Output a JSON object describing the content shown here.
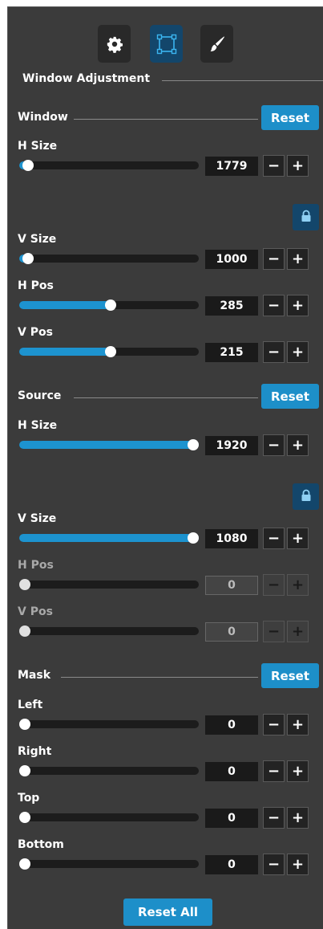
{
  "header": {
    "title": "Window Adjustment",
    "tabs": [
      {
        "icon": "gear-icon",
        "active": false
      },
      {
        "icon": "window-frame-icon",
        "active": true
      },
      {
        "icon": "brush-icon",
        "active": false
      }
    ]
  },
  "window": {
    "title": "Window",
    "reset_label": "Reset",
    "rows": [
      {
        "label": "H Size",
        "value": "1779",
        "fill": 0.05
      },
      {
        "label": "V Size",
        "value": "1000",
        "fill": 0.05
      },
      {
        "label": "H Pos",
        "value": "285",
        "fill": 0.51
      },
      {
        "label": "V Pos",
        "value": "215",
        "fill": 0.51
      }
    ]
  },
  "source": {
    "title": "Source",
    "reset_label": "Reset",
    "rows": [
      {
        "label": "H Size",
        "value": "1920",
        "fill": 1.0
      },
      {
        "label": "V Size",
        "value": "1080",
        "fill": 1.0
      },
      {
        "label": "H Pos",
        "value": "0",
        "fill": 0.0
      },
      {
        "label": "V Pos",
        "value": "0",
        "fill": 0.0
      }
    ]
  },
  "mask": {
    "title": "Mask",
    "reset_label": "Reset",
    "rows": [
      {
        "label": "Left",
        "value": "0",
        "fill": 0.0
      },
      {
        "label": "Right",
        "value": "0",
        "fill": 0.0
      },
      {
        "label": "Top",
        "value": "0",
        "fill": 0.0
      },
      {
        "label": "Bottom",
        "value": "0",
        "fill": 0.0
      }
    ]
  },
  "controls": {
    "minus": "−",
    "plus": "+"
  },
  "footer": {
    "reset_all_label": "Reset All"
  },
  "colors": {
    "panel": "#3b3b3b",
    "accent": "#1d8fc9",
    "active_tab": "#13466b"
  }
}
